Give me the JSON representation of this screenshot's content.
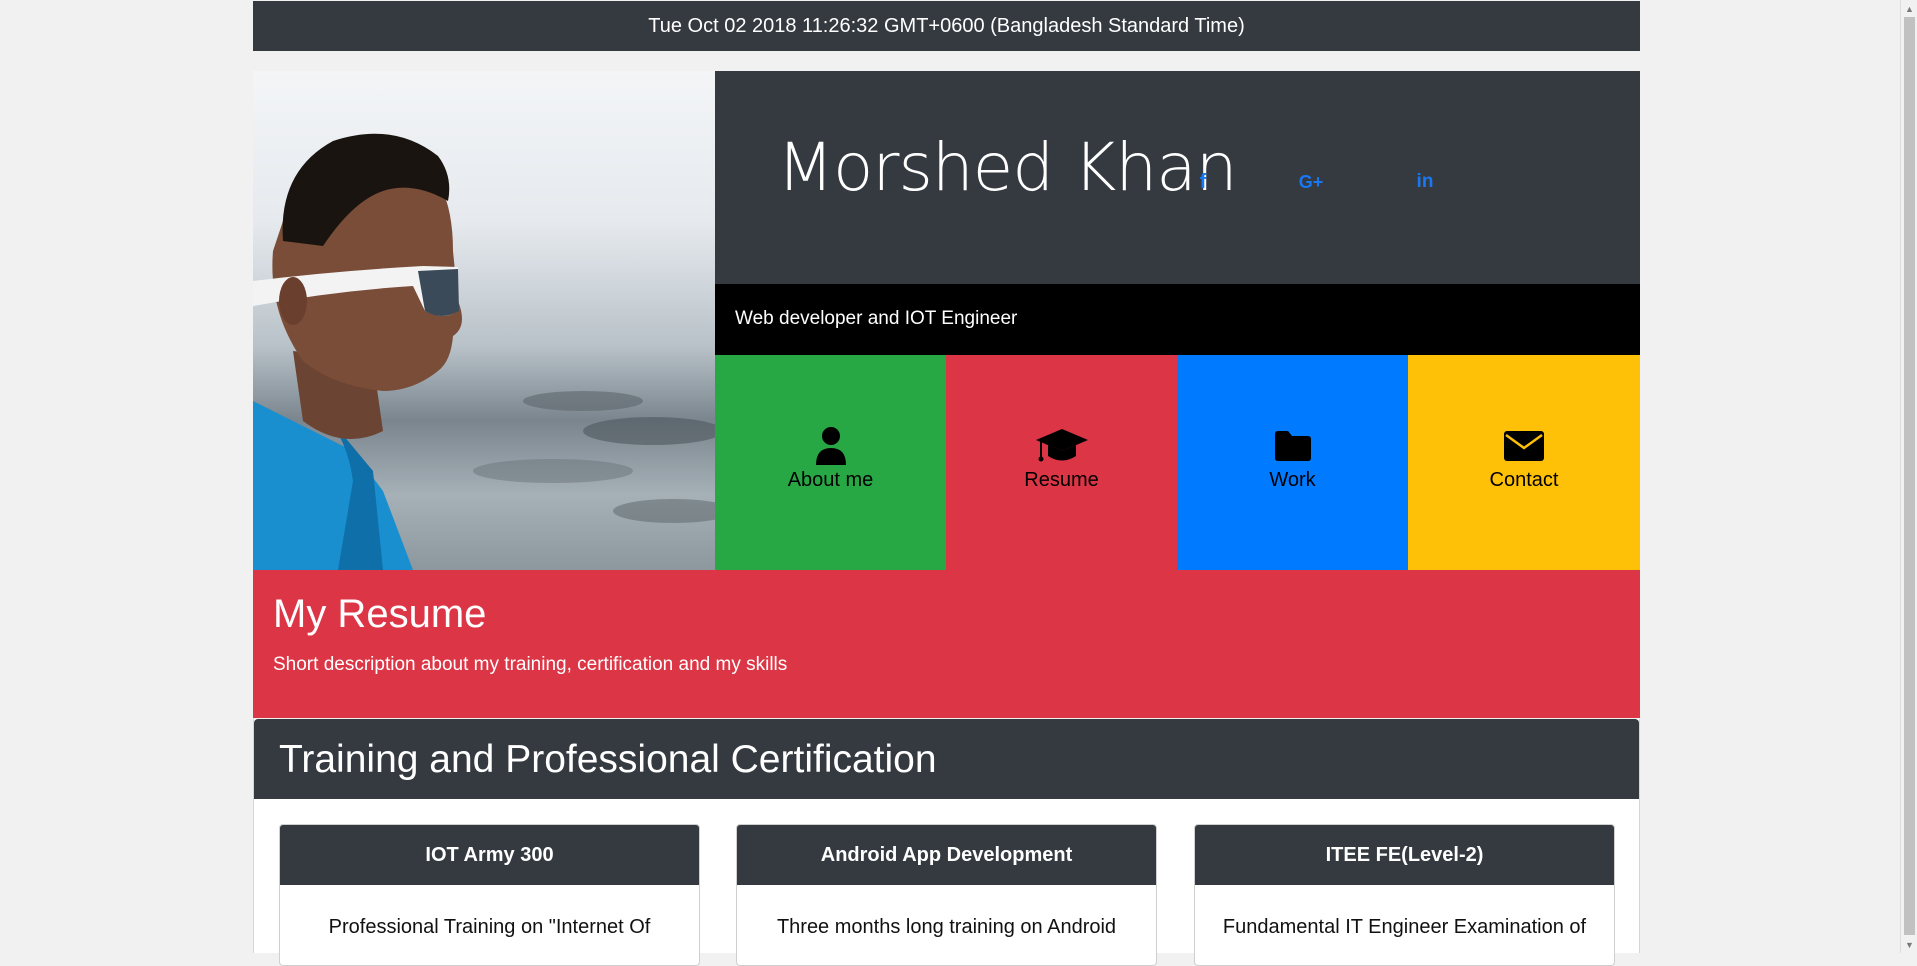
{
  "header": {
    "datetime": "Tue Oct 02 2018 11:26:32 GMT+0600 (Bangladesh Standard Time)"
  },
  "profile": {
    "name": "Morshed Khan",
    "tagline": "Web developer and IOT Engineer",
    "social": [
      {
        "label": "f",
        "icon": "facebook-icon"
      },
      {
        "label": "G+",
        "icon": "google-plus-icon"
      },
      {
        "label": "in",
        "icon": "linkedin-icon"
      }
    ]
  },
  "nav": {
    "tiles": [
      {
        "label": "About me",
        "icon": "user-icon",
        "color": "#28a745"
      },
      {
        "label": "Resume",
        "icon": "graduation-cap-icon",
        "color": "#dc3545"
      },
      {
        "label": "Work",
        "icon": "folder-icon",
        "color": "#007bff"
      },
      {
        "label": "Contact",
        "icon": "envelope-icon",
        "color": "#ffc107"
      }
    ]
  },
  "resume": {
    "title": "My Resume",
    "subtitle": "Short description about my training, certification and my skills"
  },
  "certifications": {
    "title": "Training and Professional Certification",
    "cards": [
      {
        "title": "IOT Army 300",
        "text": "Professional Training on \"Internet Of"
      },
      {
        "title": "Android App Development",
        "text": "Three months long training on Android"
      },
      {
        "title": "ITEE FE(Level-2)",
        "text": "Fundamental IT Engineer Examination of"
      }
    ]
  },
  "colors": {
    "dark": "#343a40",
    "accent_red": "#dc3545",
    "link_blue": "#1877f2"
  }
}
